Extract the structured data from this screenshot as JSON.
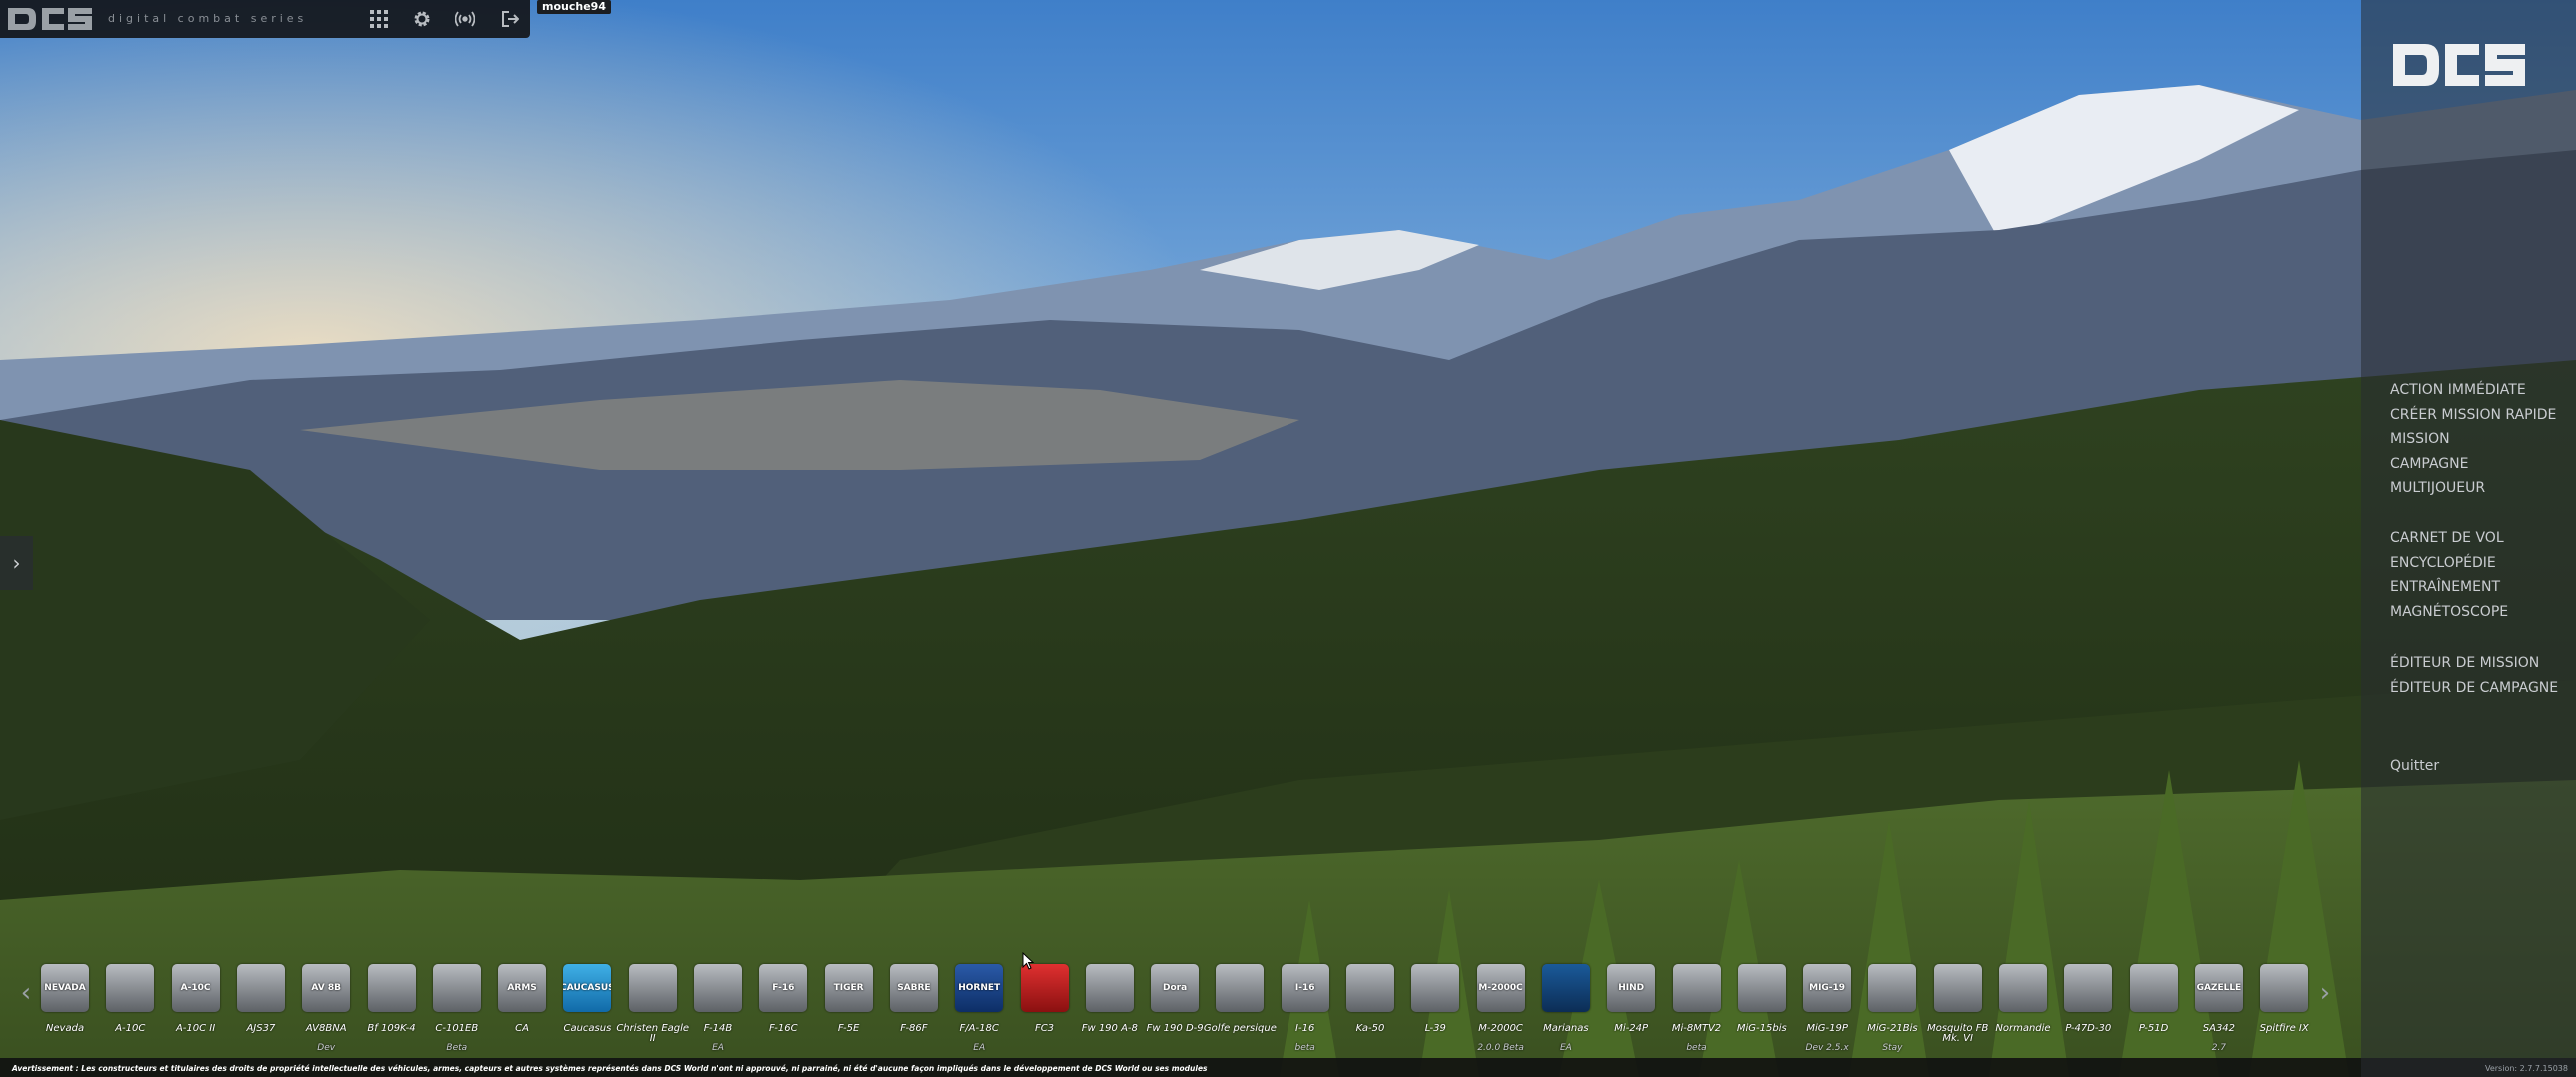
{
  "toolbar": {
    "logo_text": "DCS",
    "tagline": "digital combat series",
    "user": "mouche94"
  },
  "menu": {
    "logo_text": "DCS",
    "groups": [
      [
        "ACTION IMMÉDIATE",
        "CRÉER MISSION RAPIDE",
        "MISSION",
        "CAMPAGNE",
        "MULTIJOUEUR"
      ],
      [
        "CARNET DE VOL",
        "ENCYCLOPÉDIE",
        "ENTRAÎNEMENT",
        "MAGNÉTOSCOPE"
      ],
      [
        "ÉDITEUR DE MISSION",
        "ÉDITEUR DE CAMPAGNE"
      ],
      [
        "Quitter"
      ]
    ]
  },
  "modules": [
    {
      "name": "Nevada",
      "sub": "",
      "badge": "NEVADA"
    },
    {
      "name": "A-10C",
      "sub": "",
      "badge": ""
    },
    {
      "name": "A-10C II",
      "sub": "",
      "badge": "A-10C"
    },
    {
      "name": "AJS37",
      "sub": "",
      "badge": ""
    },
    {
      "name": "AV8BNA",
      "sub": "Dev",
      "badge": "AV 8B"
    },
    {
      "name": "Bf 109K-4",
      "sub": "",
      "badge": ""
    },
    {
      "name": "C-101EB",
      "sub": "Beta",
      "badge": ""
    },
    {
      "name": "CA",
      "sub": "",
      "badge": "ARMS"
    },
    {
      "name": "Caucasus",
      "sub": "",
      "badge": "CAUCASUS"
    },
    {
      "name": "Christen Eagle II",
      "sub": "",
      "badge": ""
    },
    {
      "name": "F-14B",
      "sub": "EA",
      "badge": ""
    },
    {
      "name": "F-16C",
      "sub": "",
      "badge": "F-16"
    },
    {
      "name": "F-5E",
      "sub": "",
      "badge": "TIGER"
    },
    {
      "name": "F-86F",
      "sub": "",
      "badge": "SABRE"
    },
    {
      "name": "F/A-18C",
      "sub": "EA",
      "badge": "HORNET"
    },
    {
      "name": "FC3",
      "sub": "",
      "badge": ""
    },
    {
      "name": "Fw 190 A-8",
      "sub": "",
      "badge": ""
    },
    {
      "name": "Fw 190 D-9",
      "sub": "",
      "badge": "Dora"
    },
    {
      "name": "Golfe persique",
      "sub": "",
      "badge": ""
    },
    {
      "name": "I-16",
      "sub": "beta",
      "badge": "I-16"
    },
    {
      "name": "Ka-50",
      "sub": "",
      "badge": ""
    },
    {
      "name": "L-39",
      "sub": "",
      "badge": ""
    },
    {
      "name": "M-2000C",
      "sub": "2.0.0 Beta",
      "badge": "M-2000C"
    },
    {
      "name": "Marianas",
      "sub": "EA",
      "badge": ""
    },
    {
      "name": "Mi-24P",
      "sub": "",
      "badge": "HIND"
    },
    {
      "name": "Mi-8MTV2",
      "sub": "beta",
      "badge": ""
    },
    {
      "name": "MiG-15bis",
      "sub": "",
      "badge": ""
    },
    {
      "name": "MiG-19P",
      "sub": "Dev 2.5.x",
      "badge": "MIG-19"
    },
    {
      "name": "MiG-21Bis",
      "sub": "Stay",
      "badge": ""
    },
    {
      "name": "Mosquito FB Mk. VI",
      "sub": "",
      "badge": ""
    },
    {
      "name": "Normandie",
      "sub": "",
      "badge": ""
    },
    {
      "name": "P-47D-30",
      "sub": "",
      "badge": ""
    },
    {
      "name": "P-51D",
      "sub": "",
      "badge": ""
    },
    {
      "name": "SA342",
      "sub": "2.7",
      "badge": "GAZELLE"
    },
    {
      "name": "Spitfire IX",
      "sub": "",
      "badge": ""
    }
  ],
  "disclaimer": "Avertissement : Les constructeurs et titulaires des droits de propriété intellectuelle des véhicules, armes, capteurs et autres systèmes représentés dans DCS World n'ont ni approuvé, ni parrainé, ni été d'aucune façon impliqués dans le développement de DCS World ou ses modules",
  "version": "Version: 2.7.7.15038"
}
